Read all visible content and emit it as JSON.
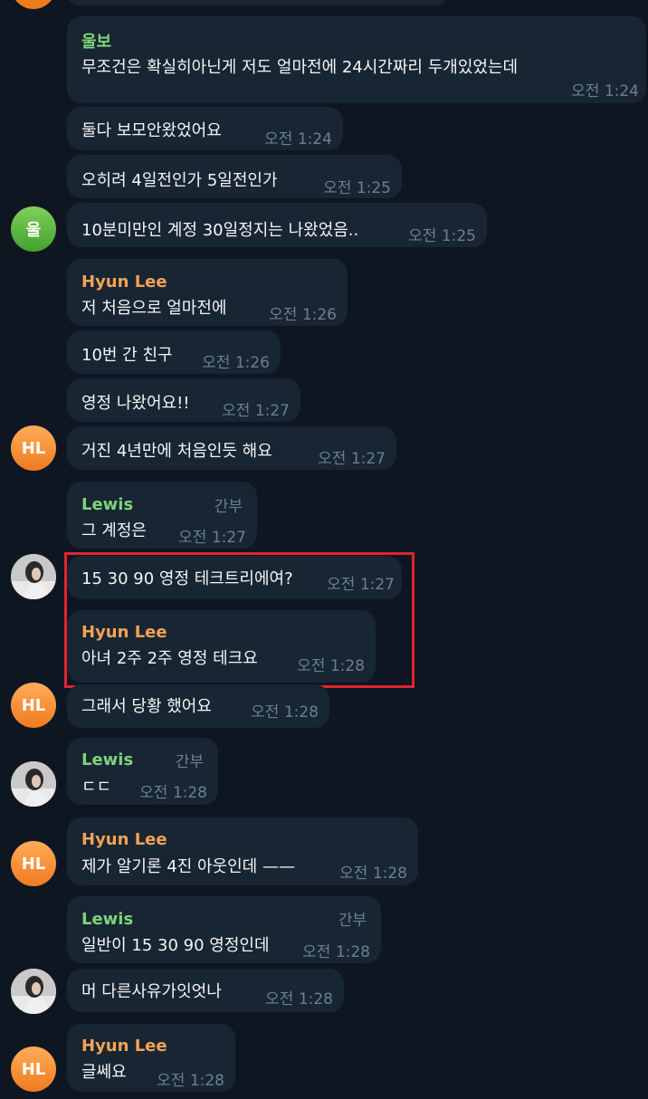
{
  "colors": {
    "background": "#0e1621",
    "bubble": "#182533",
    "name_orange": "#f5a253",
    "name_green": "#7fd47a",
    "time_gray": "#6d7f8f",
    "highlight_red": "#e0242f"
  },
  "messages": [
    {
      "sender": "울보",
      "text": "무조건은 확실히아닌게 저도 얼마전에 24시간짜리 두개있었는데",
      "time": "오전 1:24"
    },
    {
      "text": "둘다 보모안왔었어요",
      "time": "오전 1:24"
    },
    {
      "text": "오히려 4일전인가 5일전인가",
      "time": "오전 1:25"
    },
    {
      "text": "10분미만인 계정 30일정지는 나왔었음..",
      "time": "오전 1:25",
      "avatar": "울"
    },
    {
      "sender": "Hyun Lee",
      "text": "저 처음으로 얼마전에",
      "time": "오전 1:26"
    },
    {
      "text": "10번 간 친구",
      "time": "오전 1:26"
    },
    {
      "text": "영정 나왔어요!!",
      "time": "오전 1:27"
    },
    {
      "text": "거진 4년만에 처음인듯 해요",
      "time": "오전 1:27",
      "avatar": "HL"
    },
    {
      "sender": "Lewis",
      "role": "간부",
      "text": "그 계정은",
      "time": "오전 1:27"
    },
    {
      "text": "15 30 90 영정 테크트리에여?",
      "time": "오전 1:27"
    },
    {
      "sender": "Hyun Lee",
      "text": "아녀 2주 2주 영정 테크요",
      "time": "오전 1:28"
    },
    {
      "text": "그래서 당황 했어요",
      "time": "오전 1:28",
      "avatar": "HL"
    },
    {
      "sender": "Lewis",
      "role": "간부",
      "text": "ㄷㄷ",
      "time": "오전 1:28"
    },
    {
      "sender": "Hyun Lee",
      "text": "제가 알기론 4진 아웃인데 ——",
      "time": "오전 1:28",
      "avatar": "HL"
    },
    {
      "sender": "Lewis",
      "role": "간부",
      "text": "일반이 15 30 90 영정인데",
      "time": "오전 1:28"
    },
    {
      "text": "머 다른사유가잇엇나",
      "time": "오전 1:28"
    },
    {
      "sender": "Hyun Lee",
      "text": "글쎄요",
      "time": "오전 1:28",
      "avatar": "HL"
    }
  ]
}
